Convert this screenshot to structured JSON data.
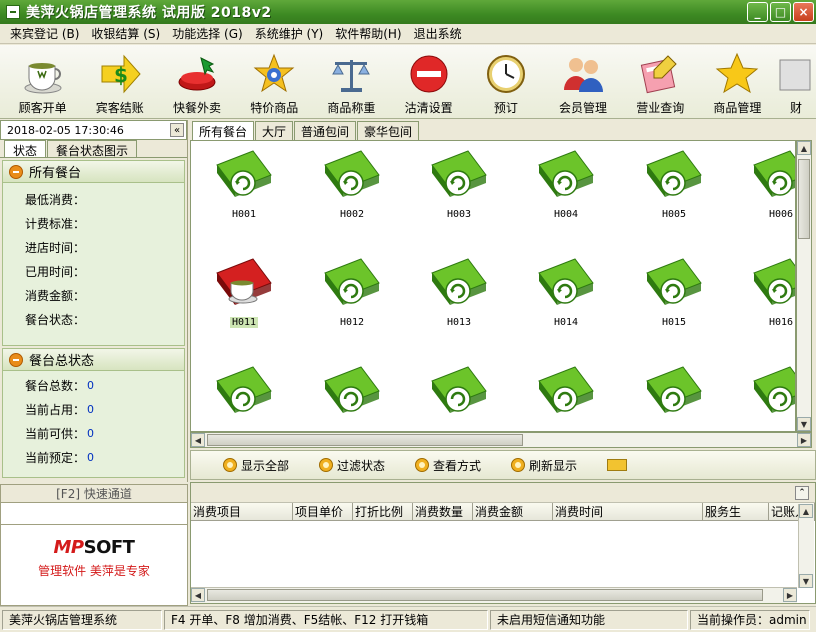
{
  "window": {
    "title": "美萍火锅店管理系统 试用版 2018v2",
    "controls": [
      "_",
      "□",
      "×"
    ]
  },
  "menu": [
    "来宾登记 (B)",
    "收银结算 (S)",
    "功能选择 (G)",
    "系统维护 (Y)",
    "软件帮助(H)",
    "退出系统"
  ],
  "toolbar": [
    {
      "label": "顾客开单",
      "icon": "tea-cup-icon"
    },
    {
      "label": "宾客结账",
      "icon": "dollar-arrow-icon"
    },
    {
      "label": "快餐外卖",
      "icon": "takeout-icon"
    },
    {
      "label": "特价商品",
      "icon": "special-offer-icon"
    },
    {
      "label": "商品称重",
      "icon": "scale-icon"
    },
    {
      "label": "沽清设置",
      "icon": "no-entry-icon"
    },
    {
      "label": "预订",
      "icon": "clock-icon"
    },
    {
      "label": "会员管理",
      "icon": "members-icon"
    },
    {
      "label": "营业查询",
      "icon": "notebook-icon"
    },
    {
      "label": "商品管理",
      "icon": "star-icon"
    },
    {
      "label": "财",
      "icon": "finance-icon"
    }
  ],
  "left": {
    "datetime": "2018-02-05 17:30:46",
    "collapse": "«",
    "tabs": [
      "状态",
      "餐台状态图示"
    ],
    "all_tables": {
      "title": "所有餐台",
      "rows": [
        "最低消费：",
        "计费标准：",
        "进店时间：",
        "已用时间：",
        "消费金额：",
        "餐台状态："
      ]
    },
    "summary": {
      "title": "餐台总状态",
      "rows": [
        {
          "label": "餐台总数：",
          "value": "0"
        },
        {
          "label": "当前占用：",
          "value": "0"
        },
        {
          "label": "当前可供：",
          "value": "0"
        },
        {
          "label": "当前预定：",
          "value": "0"
        }
      ]
    },
    "quick": {
      "title_key": "[F2]",
      "title": "快速通道",
      "brand_m": "MP",
      "brand_rest": "SOFT",
      "slogan": "管理软件  美萍是专家"
    }
  },
  "table_tabs": [
    "所有餐台",
    "大厅",
    "普通包间",
    "豪华包间"
  ],
  "tables": [
    {
      "id": "H001",
      "status": "free"
    },
    {
      "id": "H002",
      "status": "free"
    },
    {
      "id": "H003",
      "status": "free"
    },
    {
      "id": "H004",
      "status": "free"
    },
    {
      "id": "H005",
      "status": "free"
    },
    {
      "id": "H006",
      "status": "free"
    },
    {
      "id": "H011",
      "status": "occupied",
      "selected": true
    },
    {
      "id": "H012",
      "status": "free"
    },
    {
      "id": "H013",
      "status": "free"
    },
    {
      "id": "H014",
      "status": "free"
    },
    {
      "id": "H015",
      "status": "free"
    },
    {
      "id": "H016",
      "status": "free"
    }
  ],
  "actions": [
    "显示全部",
    "过滤状态",
    "查看方式",
    "刷新显示"
  ],
  "consumption_columns": [
    "消费项目",
    "项目单价",
    "打折比例",
    "消费数量",
    "消费金额",
    "消费时间",
    "服务生",
    "记账人"
  ],
  "status": [
    "美萍火锅店管理系统",
    "F4 开单、F8 增加消费、F5结帐、F12 打开钱箱",
    "未启用短信通知功能",
    "当前操作员：admin"
  ],
  "colors": {
    "free_table": "#6cc42a",
    "occupied_table": "#d42020",
    "accent": "#3d8a23"
  }
}
